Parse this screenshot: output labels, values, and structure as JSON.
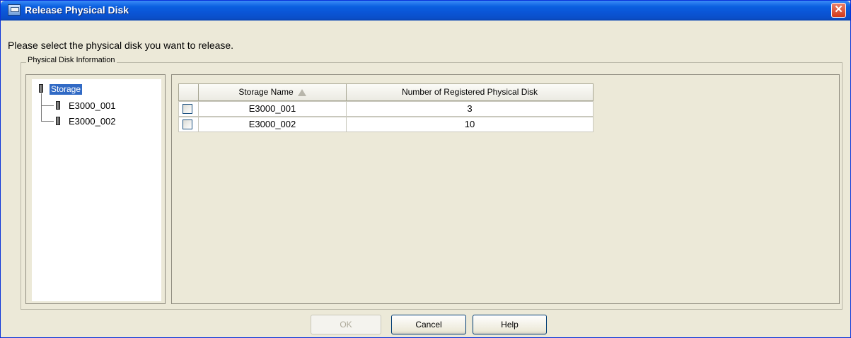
{
  "window": {
    "title": "Release Physical Disk",
    "close_icon": "close-icon",
    "app_icon": "disk-icon"
  },
  "prompt": "Please select the physical disk you want to release.",
  "group_label": "Physical Disk Information",
  "tree": {
    "root": "Storage",
    "children": [
      "E3000_001",
      "E3000_002"
    ]
  },
  "table": {
    "columns": [
      "Storage Name",
      "Number of Registered Physical Disk"
    ],
    "sorted_column": "Storage Name",
    "sort_direction": "ascending",
    "rows": [
      {
        "checked": false,
        "storage_name": "E3000_001",
        "count": "3"
      },
      {
        "checked": false,
        "storage_name": "E3000_002",
        "count": "10"
      }
    ]
  },
  "buttons": {
    "ok": "OK",
    "ok_enabled": false,
    "cancel": "Cancel",
    "help": "Help"
  },
  "colors": {
    "titlebar": "#0a55d6",
    "selection": "#316ac5",
    "close": "#d2391a"
  }
}
